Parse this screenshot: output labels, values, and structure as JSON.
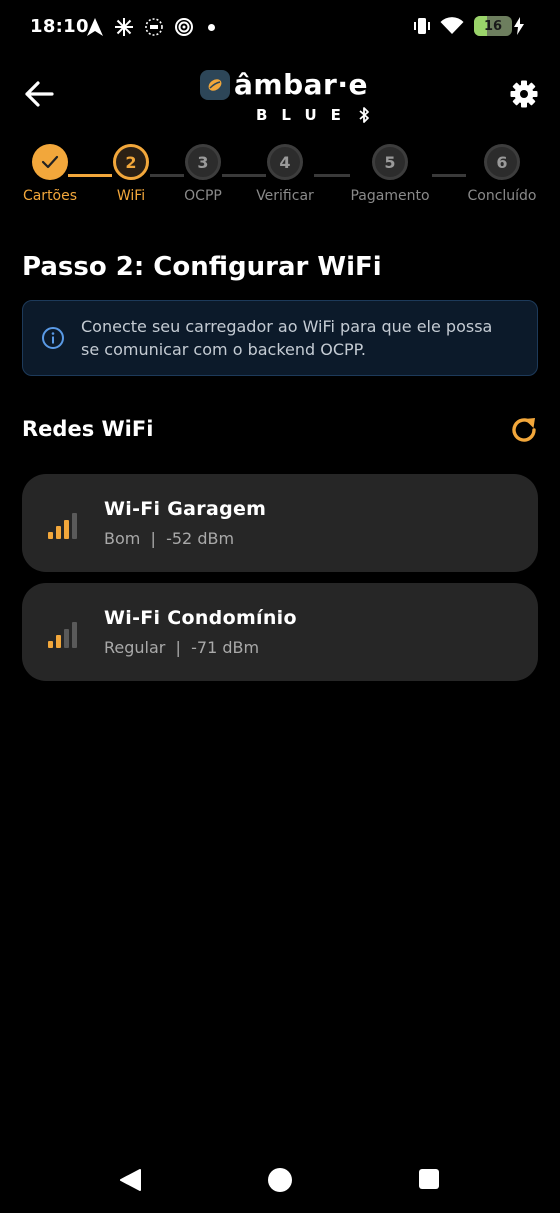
{
  "status_bar": {
    "time": "18:10",
    "battery_level": "16",
    "icons_left": [
      "navigation-icon",
      "sparkle-icon",
      "circle-dashed-icon",
      "spiral-icon",
      "dot-icon"
    ],
    "icons_right": [
      "vibrate-icon",
      "wifi-icon",
      "battery-icon",
      "charging-icon"
    ]
  },
  "header": {
    "logo_word": "âmbar·e",
    "logo_sub": "BLUE",
    "back_icon": "arrow-left-icon",
    "settings_icon": "gear-icon"
  },
  "stepper": {
    "steps": [
      {
        "label": "Cartões",
        "number": "1",
        "state": "done"
      },
      {
        "label": "WiFi",
        "number": "2",
        "state": "active"
      },
      {
        "label": "OCPP",
        "number": "3",
        "state": "todo"
      },
      {
        "label": "Verificar",
        "number": "4",
        "state": "todo"
      },
      {
        "label": "Pagamento",
        "number": "5",
        "state": "todo"
      },
      {
        "label": "Concluído",
        "number": "6",
        "state": "todo"
      }
    ]
  },
  "main": {
    "title": "Passo 2: Configurar WiFi",
    "info_text": "Conecte seu carregador ao WiFi para que ele possa se comunicar com o backend OCPP.",
    "section_title": "Redes WiFi",
    "networks": [
      {
        "name": "Wi-Fi Garagem",
        "quality": "Bom",
        "signal": "-52 dBm",
        "bars": 3
      },
      {
        "name": "Wi-Fi Condomínio",
        "quality": "Regular",
        "signal": "-71 dBm",
        "bars": 2
      }
    ]
  },
  "colors": {
    "accent": "#f2a73b",
    "background": "#000000",
    "card": "#262626",
    "info_bg": "#0c1a2a",
    "info_border": "#1d3a5a",
    "info_icon": "#5a9ae6"
  }
}
